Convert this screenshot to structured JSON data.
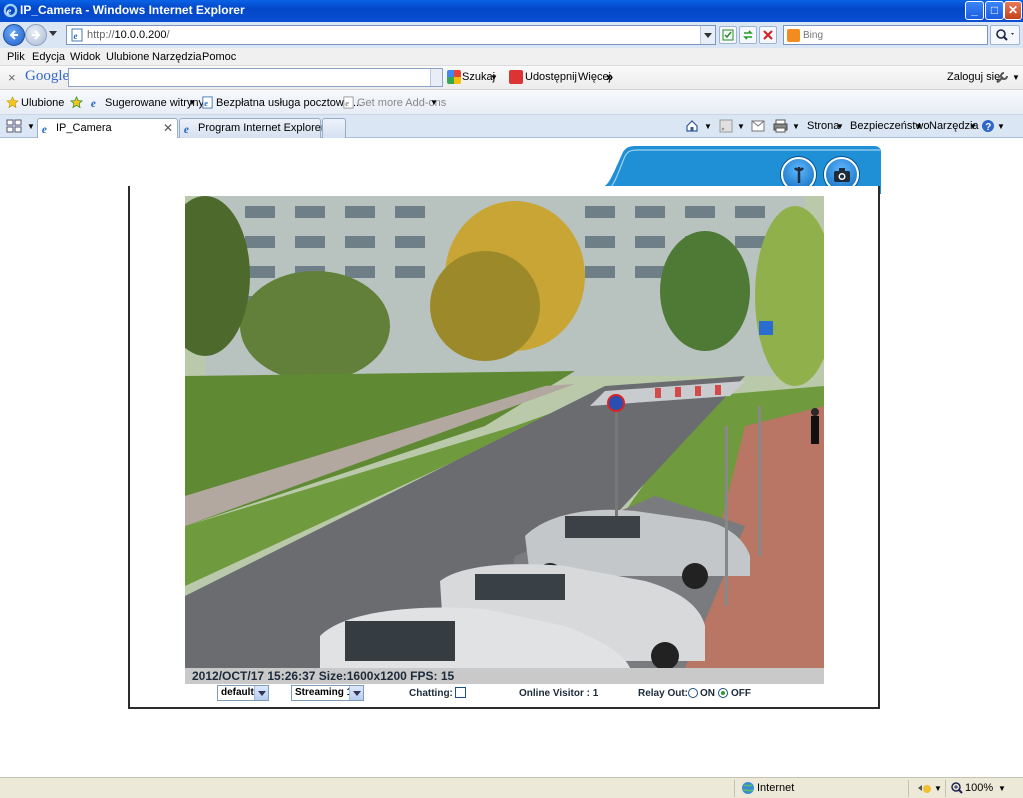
{
  "window": {
    "title": "IP_Camera - Windows Internet Explorer",
    "minimize": "_",
    "maximize": "□",
    "close": "✕"
  },
  "address": {
    "protocol": "http://",
    "host": "10.0.0.200",
    "path": "/",
    "search_placeholder": "Bing"
  },
  "menu": [
    "Plik",
    "Edycja",
    "Widok",
    "Ulubione",
    "Narzędzia",
    "Pomoc"
  ],
  "google_toolbar": {
    "logo": "Google",
    "search_btn": "Szukaj",
    "share_btn": "Udostępnij",
    "more_btn": "Więcej",
    "more_chevron": "»",
    "signin": "Zaloguj się"
  },
  "favorites": {
    "label": "Ulubione",
    "items": [
      "Sugerowane witryny",
      "Bezpłatna usługa pocztowa ...",
      "Get more Add-ons"
    ]
  },
  "tabs": [
    {
      "label": "IP_Camera",
      "active": true
    },
    {
      "label": "Program Internet Explorer ni...",
      "active": false
    }
  ],
  "commands": {
    "page": "Strona",
    "safety": "Bezpieczeństwo",
    "tools": "Narzędzia"
  },
  "camera": {
    "overlay": "2012/OCT/17 15:26:37 Size:1600x1200 FPS: 15",
    "profile_select": "default",
    "stream_select": "Streaming 1",
    "chatting_label": "Chatting:",
    "visitor_label": "Online Visitor : 1",
    "relay_label": "Relay Out:",
    "relay_on": "ON",
    "relay_off": "OFF",
    "relay_state": "OFF",
    "chatting_checked": false
  },
  "status": {
    "zone": "Internet",
    "zoom": "100%"
  },
  "colors": {
    "accent": "#1f8fd6",
    "frame_border": "#2b2b2b"
  }
}
